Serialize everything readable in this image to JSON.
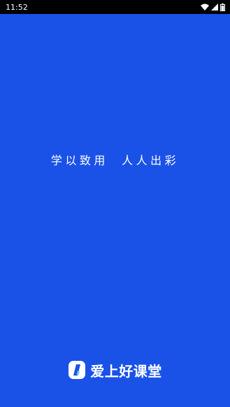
{
  "status_bar": {
    "time": "11:52",
    "icons": [
      "wifi-icon",
      "cellular-signal-icon",
      "battery-icon"
    ]
  },
  "splash": {
    "slogan": "学以致用  人人出彩",
    "brand_name": "爱上好课堂",
    "logo_icon": "brand-logo-icon"
  },
  "colors": {
    "background": "#1a52e8",
    "status_bar": "#000000",
    "text": "#ffffff"
  }
}
